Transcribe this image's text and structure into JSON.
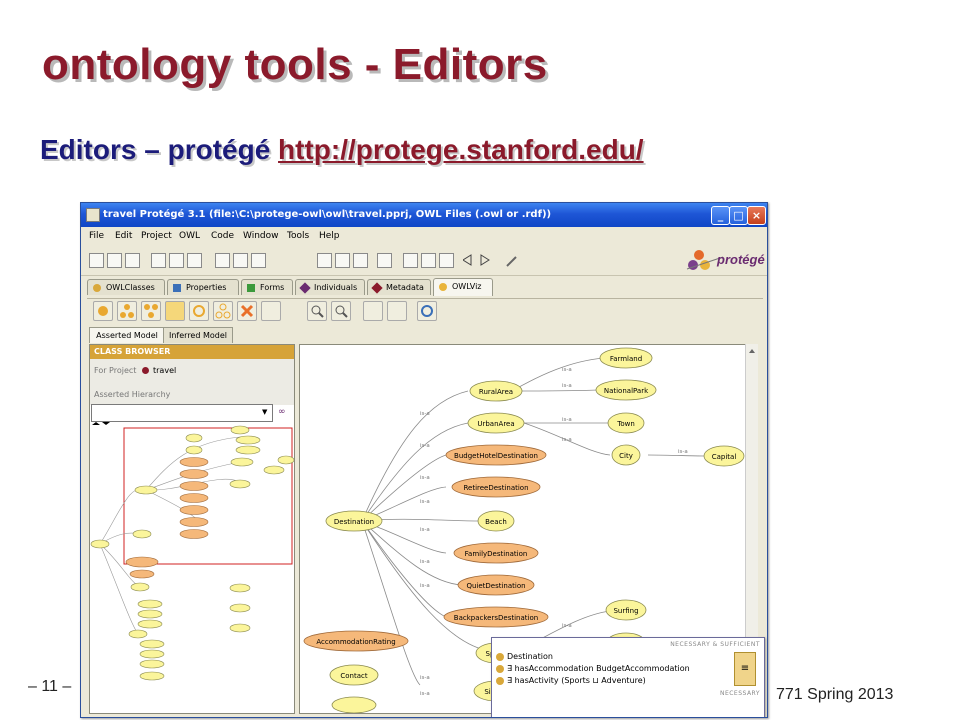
{
  "slide": {
    "title": "ontology tools - Editors",
    "subtitle_prefix": "Editors – protégé",
    "subtitle_link": "http://protege.stanford.edu/",
    "page_number": "– 11 –",
    "footer_right": "771 Spring 2013"
  },
  "window": {
    "title": "travel  Protégé 3.1     (file:\\C:\\protege-owl\\owl\\travel.pprj, OWL Files (.owl or .rdf))",
    "min": "_",
    "max": "□",
    "close": "×"
  },
  "menu": [
    "File",
    "Edit",
    "Project",
    "OWL",
    "Code",
    "Window",
    "Tools",
    "Help"
  ],
  "logo": "protégé",
  "tabs": [
    "OWLClasses",
    "Properties",
    "Forms",
    "Individuals",
    "Metadata",
    "OWLViz"
  ],
  "subtabs": [
    "Asserted Model",
    "Inferred Model"
  ],
  "class_browser": {
    "header": "CLASS BROWSER",
    "for_project_label": "For Project",
    "project": "travel",
    "hierarchy_label": "Asserted Hierarchy"
  },
  "graph": {
    "edge_label": "is-a",
    "nodes": {
      "farmland": "Farmland",
      "ruralarea": "RuralArea",
      "nationalpark": "NationalPark",
      "urbanarea": "UrbanArea",
      "town": "Town",
      "budgethotel": "BudgetHotelDestination",
      "city": "City",
      "capital": "Capital",
      "retiree": "RetireeDestination",
      "destination": "Destination",
      "beach": "Beach",
      "family": "FamilyDestination",
      "quiet": "QuietDestination",
      "backpackers": "BackpackersDestination",
      "surfing": "Surfing",
      "accommodationrating": "AccommodationRating",
      "contact": "Contact",
      "sports_partial": "Sp",
      "sightseeing_partial": "Sigh"
    }
  },
  "popup": {
    "header_nec_suff": "NECESSARY & SUFFICIENT",
    "header_nec": "NECESSARY",
    "line1": "Destination",
    "line2": "∃ hasAccommodation BudgetAccommodation",
    "line3": "∃ hasActivity (Sports ⊔ Adventure)",
    "equiv_symbol": "≡"
  },
  "colors": {
    "title": "#8b1a2b",
    "subtitle": "#1c1c7a",
    "node_yellow": "#fbf59b",
    "node_orange": "#f5b87a",
    "header_gold": "#d6a338"
  }
}
